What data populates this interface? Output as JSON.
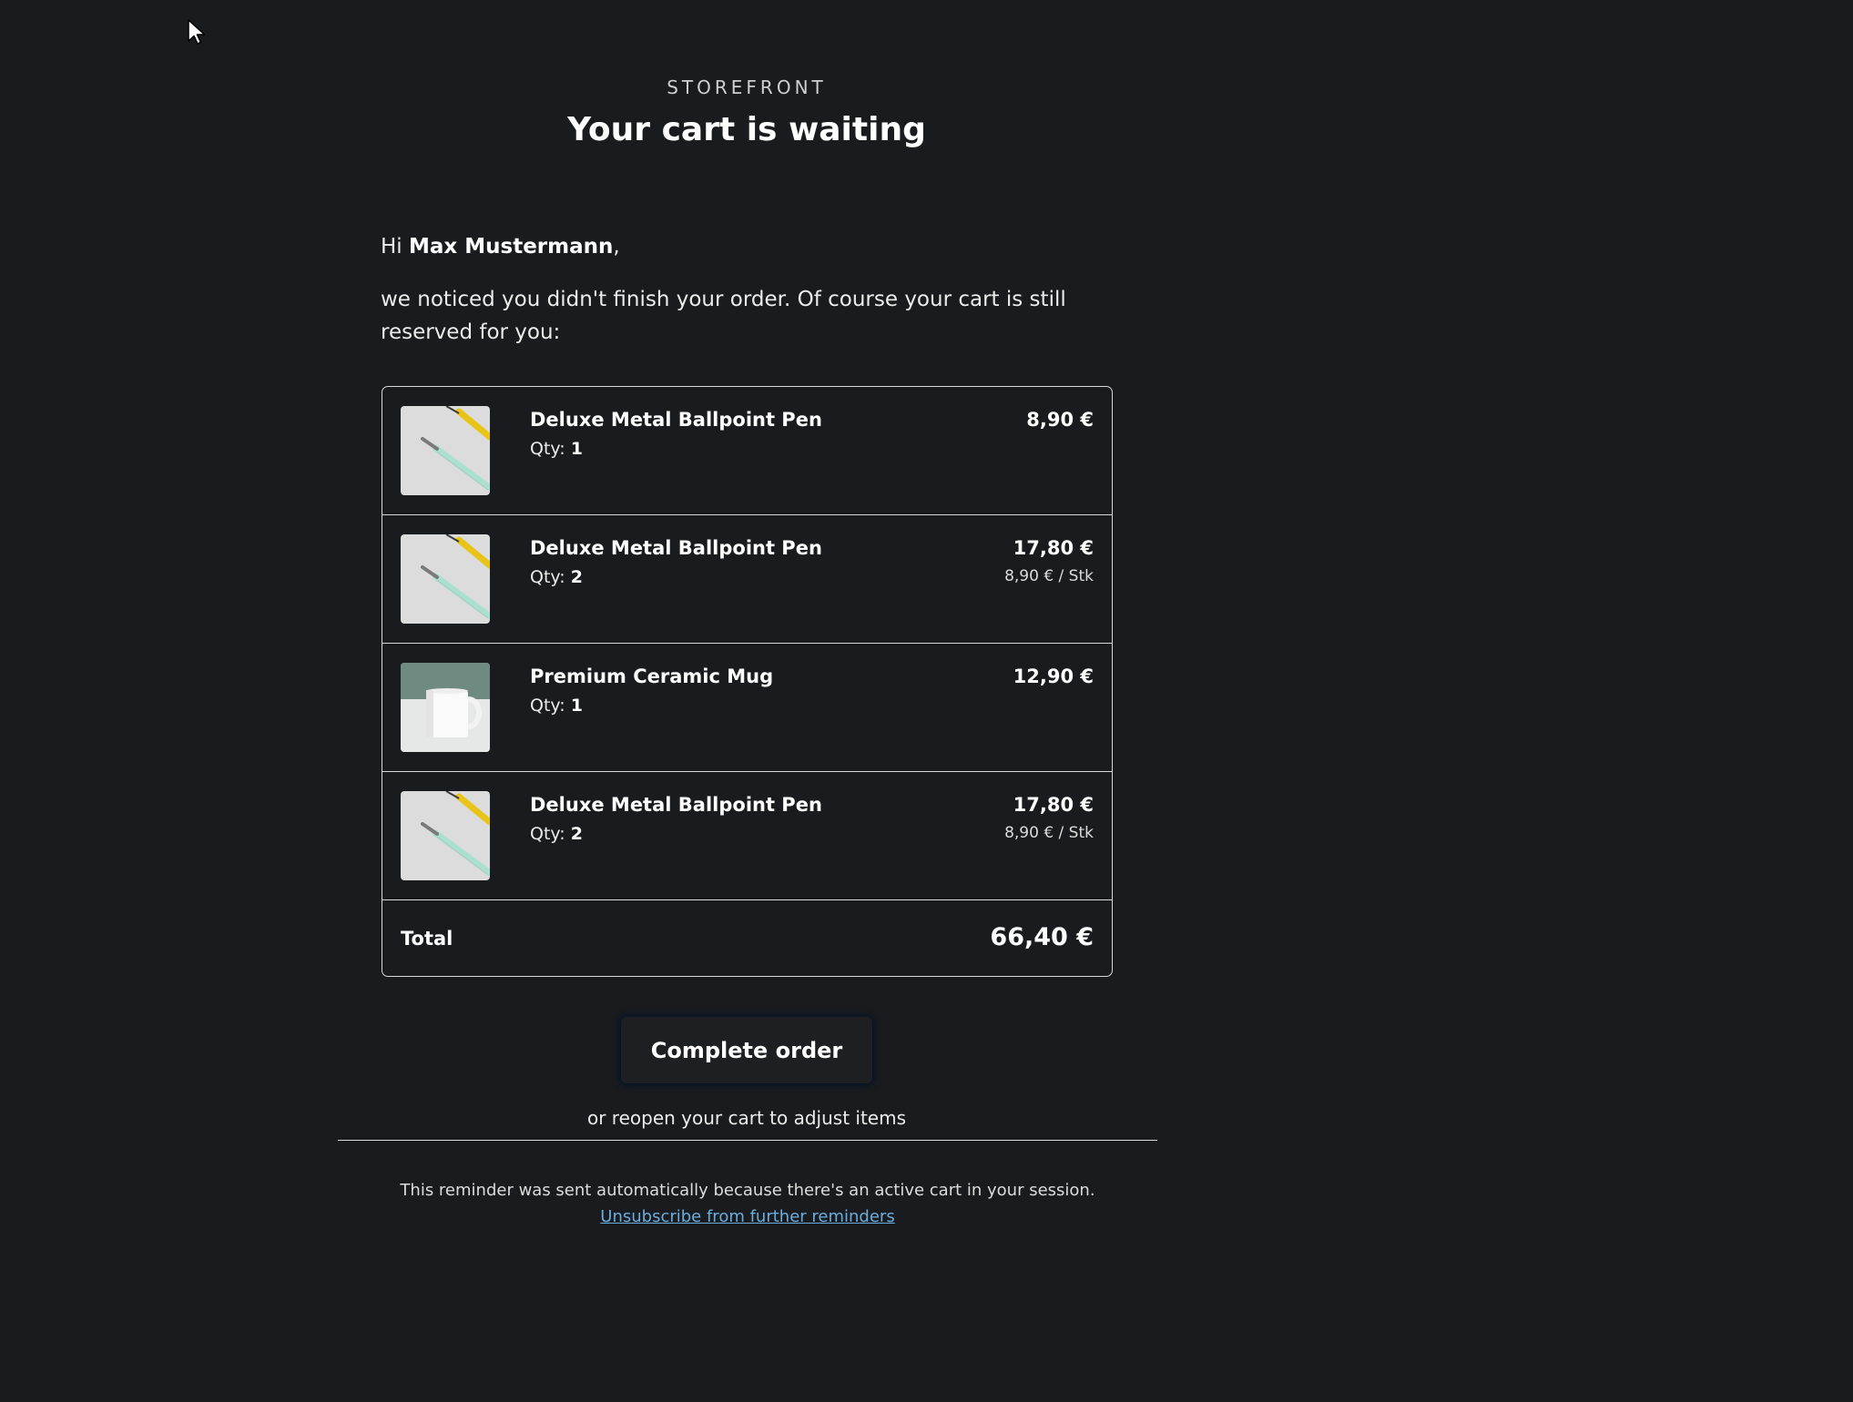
{
  "header": {
    "brand": "STOREFRONT",
    "title": "Your cart is waiting"
  },
  "greeting": {
    "prefix": "Hi ",
    "name": "Max Mustermann",
    "suffix": ","
  },
  "intro": "we noticed you didn't finish your order. Of course your cart is still reserved for you:",
  "cart": {
    "qty_label": "Qty: ",
    "items": [
      {
        "name": "Deluxe Metal Ballpoint Pen",
        "qty": "1",
        "price": "8,90 €",
        "unit_price": "",
        "image": "pen-image"
      },
      {
        "name": "Deluxe Metal Ballpoint Pen",
        "qty": "2",
        "price": "17,80 €",
        "unit_price": "8,90 € / Stk",
        "image": "pen-image"
      },
      {
        "name": "Premium Ceramic Mug",
        "qty": "1",
        "price": "12,90 €",
        "unit_price": "",
        "image": "mug-image"
      },
      {
        "name": "Deluxe Metal Ballpoint Pen",
        "qty": "2",
        "price": "17,80 €",
        "unit_price": "8,90 € / Stk",
        "image": "pen-image"
      }
    ],
    "total_label": "Total",
    "total_value": "66,40 €"
  },
  "cta": {
    "label": "Complete order",
    "secondary": "or reopen your cart to adjust items"
  },
  "footer": {
    "notice": "This reminder was sent automatically because there's an active cart in your session.",
    "unsubscribe": "Unsubscribe from further reminders"
  },
  "colors": {
    "background": "#1a1b1e",
    "text": "#ececec",
    "border": "#d9d9d9",
    "link": "#6aaedf"
  },
  "icons": {
    "cursor": "mouse-pointer-icon"
  }
}
